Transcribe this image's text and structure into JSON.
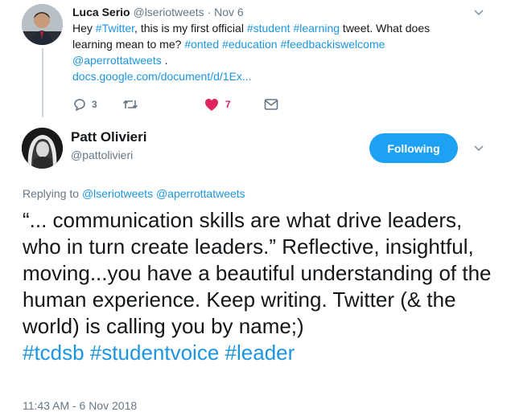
{
  "tweet1": {
    "author_name": "Luca Serio",
    "author_handle": "@lseriotweets",
    "separator": "·",
    "date": "Nov 6",
    "text": {
      "p1": "Hey ",
      "tag1": "#Twitter",
      "p2": ", this is my first official ",
      "tag2": "#student",
      "p3": " ",
      "tag3": "#learning",
      "p4": " tweet. What does learning mean to me? ",
      "tag4": "#onted",
      "p5": " ",
      "tag5": "#education",
      "p6": " ",
      "tag6": "#feedbackiswelcome",
      "mention": "@aperrottatweets",
      "p7": " .",
      "link": "docs.google.com/document/d/1Ex..."
    },
    "reply_count": "3",
    "like_count": "7",
    "icons": [
      "reply-icon",
      "retweet-icon",
      "heart-icon",
      "message-icon",
      "chevron-down-icon"
    ]
  },
  "tweet2": {
    "author_name": "Patt Olivieri",
    "author_handle": "@pattolivieri",
    "follow_label": "Following",
    "replying": {
      "prefix": "Replying to ",
      "mention1": "@lseriotweets",
      "mention2": "@aperrottatweets"
    },
    "text": {
      "body": "“... communication skills are what drive leaders, who in turn create leaders.” Reflective, insightful, moving...you have a beautiful understanding of the human experience. Keep writing. Twitter (& the world) is calling you by name;)",
      "tag1": "#tcdsb",
      "tag2": "#studentvoice",
      "tag3": "#leader"
    },
    "timestamp": "11:43 AM - 6 Nov 2018"
  },
  "colors": {
    "link": "#1b95e0",
    "follow_button": "#1da1f2",
    "like": "#e0245e",
    "muted": "#657786"
  }
}
